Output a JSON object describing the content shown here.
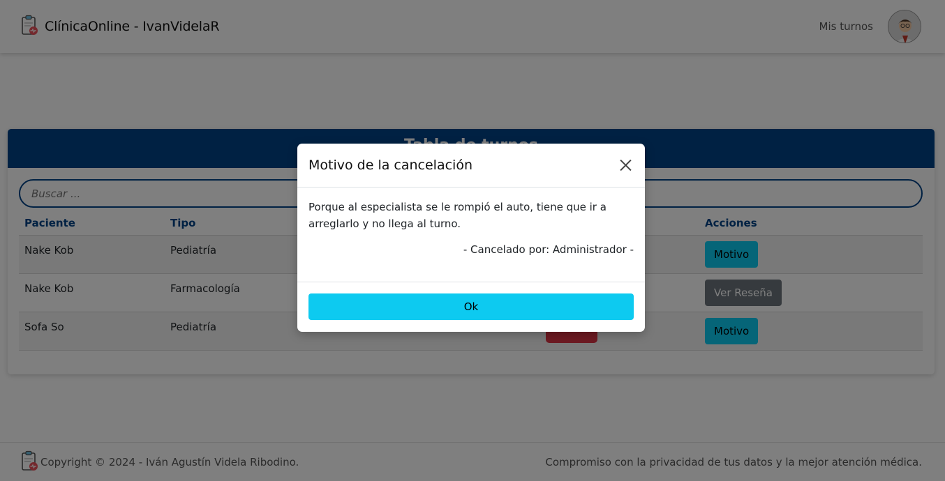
{
  "navbar": {
    "brand_title": "ClínicaOnline - IvanVidelaR",
    "link_label": "Mis turnos"
  },
  "card": {
    "header_title": "Tabla de turnos",
    "search_placeholder": "Buscar ...",
    "columns": {
      "paciente": "Paciente",
      "tipo": "Tipo",
      "acciones": "Acciones"
    },
    "rows": [
      {
        "paciente": "Nake Kob",
        "tipo": "Pediatría",
        "action": "Motivo"
      },
      {
        "paciente": "Nake Kob",
        "tipo": "Farmacología",
        "action": "Ver Reseña"
      },
      {
        "paciente": "Sofa So",
        "tipo": "Pediatría",
        "action": "Motivo"
      }
    ]
  },
  "modal": {
    "title": "Motivo de la cancelación",
    "reason": "Porque al especialista se le rompió el auto, tiene que ir a arreglarlo y no llega al turno.",
    "cancelled_by": "- Cancelado por: Administrador -",
    "ok_label": "Ok"
  },
  "footer": {
    "copyright": "Copyright © 2024 - Iván Agustín Videla Ribodino.",
    "tagline": "Compromiso con la privacidad de tus datos y la mejor atención médica."
  },
  "colors": {
    "primary": "#004387",
    "info": "#0dcaf0",
    "secondary": "#6c757d",
    "danger": "#dc3545"
  },
  "icons": [
    "clipboard-health-icon",
    "doctor-avatar-icon",
    "close-icon"
  ]
}
